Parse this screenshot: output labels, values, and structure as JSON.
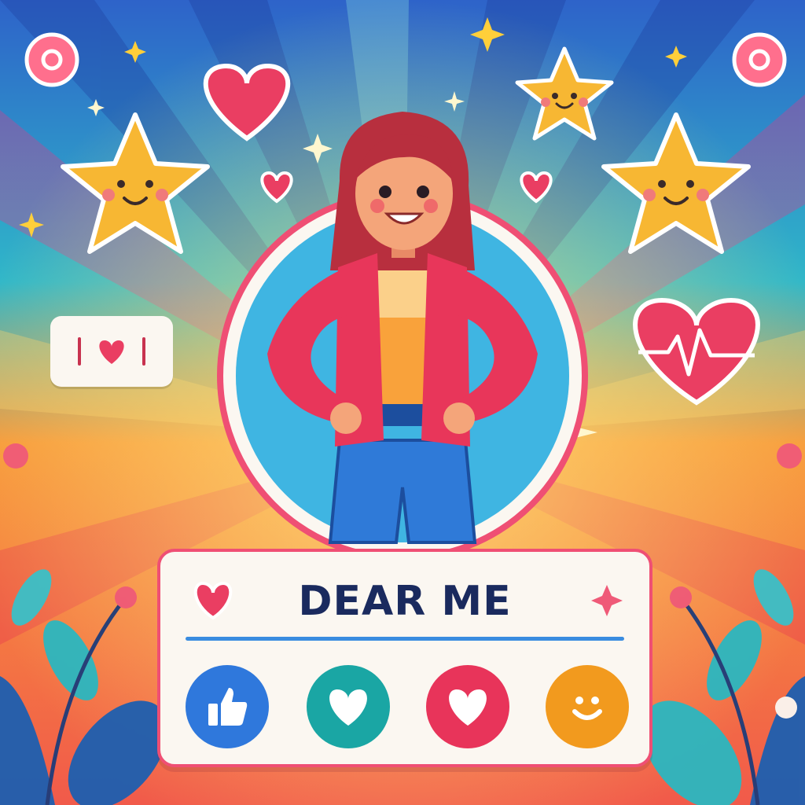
{
  "card": {
    "title": "DEAR ME",
    "reactions": [
      {
        "name": "like",
        "icon": "thumbs-up-icon",
        "color": "#2f78dc"
      },
      {
        "name": "love",
        "icon": "heart-icon",
        "color": "#1aa6a4"
      },
      {
        "name": "care",
        "icon": "heart-icon",
        "color": "#e8345a"
      },
      {
        "name": "happy",
        "icon": "smile-icon",
        "color": "#f29a1e"
      }
    ]
  },
  "colors": {
    "accent": "#ef4f74",
    "title": "#1a2a5e",
    "rule": "#3a8ce0",
    "star": "#f7b733",
    "heart": "#ea3e62"
  }
}
